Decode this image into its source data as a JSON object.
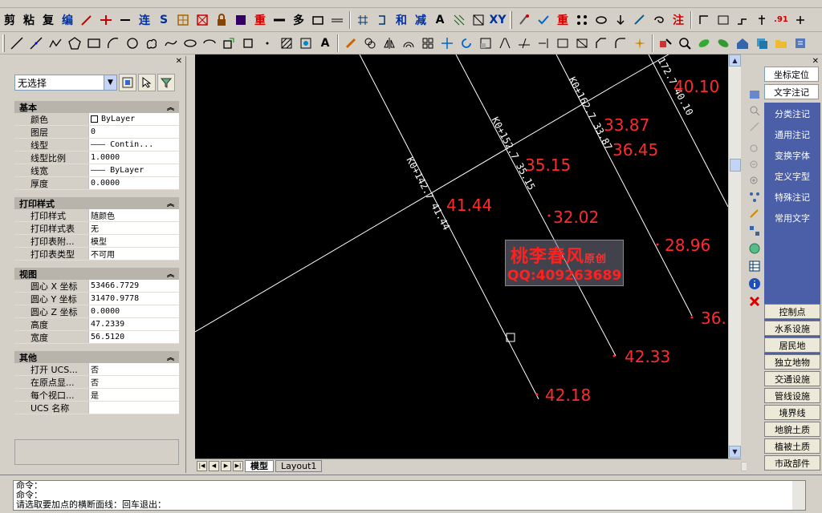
{
  "toolbar1": {
    "labels": [
      "剪",
      "粘",
      "复",
      "编",
      "连",
      "S",
      "重",
      "多",
      "和",
      "减",
      "A",
      "XY",
      "重",
      "注",
      ".91"
    ]
  },
  "toolbar2": {
    "text_button": "A"
  },
  "properties": {
    "selection": "无选择",
    "sections": {
      "basic": {
        "header": "基本",
        "rows": [
          {
            "key": "颜色",
            "value": "ByLayer"
          },
          {
            "key": "图层",
            "value": "0"
          },
          {
            "key": "线型",
            "value": "——— Contin..."
          },
          {
            "key": "线型比例",
            "value": "1.0000"
          },
          {
            "key": "线宽",
            "value": "——— ByLayer"
          },
          {
            "key": "厚度",
            "value": "0.0000"
          }
        ]
      },
      "plot": {
        "header": "打印样式",
        "rows": [
          {
            "key": "打印样式",
            "value": "随颜色"
          },
          {
            "key": "打印样式表",
            "value": "无"
          },
          {
            "key": "打印表附...",
            "value": "模型"
          },
          {
            "key": "打印表类型",
            "value": "不可用"
          }
        ]
      },
      "view": {
        "header": "视图",
        "rows": [
          {
            "key": "圆心 X 坐标",
            "value": "53466.7729"
          },
          {
            "key": "圆心 Y 坐标",
            "value": "31470.9778"
          },
          {
            "key": "圆心 Z 坐标",
            "value": "0.0000"
          },
          {
            "key": "高度",
            "value": "47.2339"
          },
          {
            "key": "宽度",
            "value": "56.5120"
          }
        ]
      },
      "misc": {
        "header": "其他",
        "rows": [
          {
            "key": "打开 UCS...",
            "value": "否"
          },
          {
            "key": "在原点显...",
            "value": "否"
          },
          {
            "key": "每个视口...",
            "value": "是"
          },
          {
            "key": "UCS 名称",
            "value": ""
          }
        ]
      }
    }
  },
  "drawing": {
    "section_labels": [
      "K0+142.7 41.44",
      "K0+152.7 35.15",
      "K0+162.7 33.87",
      "172.7 40.10"
    ],
    "elevations": [
      "41.44",
      "35.15",
      "33.87",
      "40.10",
      "36.45",
      "32.02",
      "28.96",
      "36.",
      "42.33",
      "42.18"
    ],
    "watermark": {
      "title": "桃李春风",
      "subtitle": "原创",
      "qq": "QQ:409263689"
    }
  },
  "layout_tabs": [
    "模型",
    "Layout1"
  ],
  "right_panel": {
    "top_buttons": [
      "坐标定位",
      "文字注记"
    ],
    "annotation_items": [
      "分类注记",
      "通用注记",
      "变换字体",
      "定义字型",
      "特殊注记",
      "常用文字"
    ],
    "category_buttons": [
      "控制点",
      "水系设施",
      "居民地",
      "独立地物",
      "交通设施",
      "管线设施",
      "境界线",
      "地貌土质",
      "植被土质",
      "市政部件"
    ]
  },
  "command": {
    "lines": [
      "命令：",
      "命令：",
      "请选取要加点的横断面线：回车退出："
    ]
  }
}
